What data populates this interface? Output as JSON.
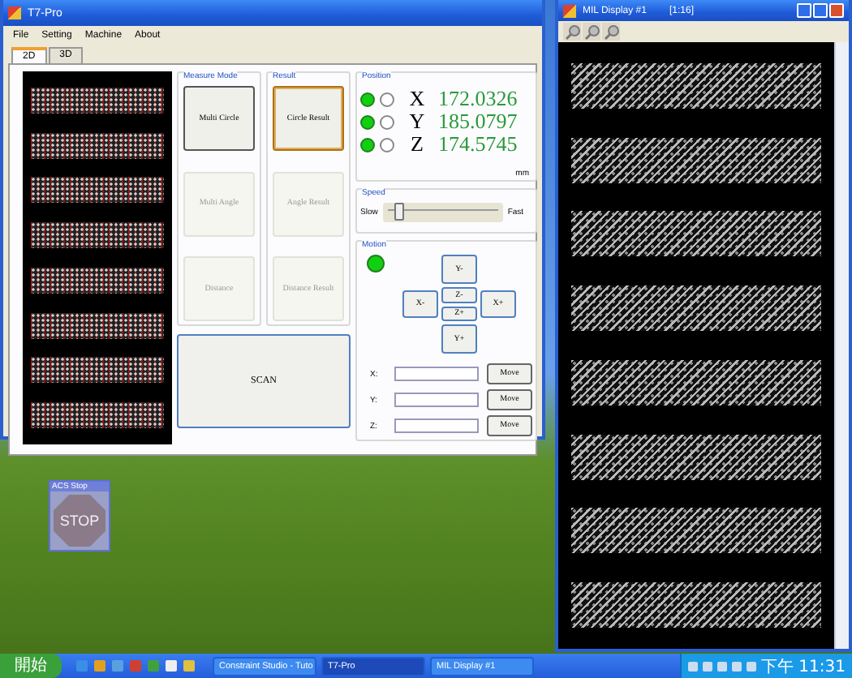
{
  "main_window": {
    "title": "T7-Pro",
    "menu": [
      "File",
      "Setting",
      "Machine",
      "About"
    ],
    "tabs": [
      {
        "label": "2D",
        "selected": true
      },
      {
        "label": "3D",
        "selected": false
      }
    ],
    "measure_mode": {
      "title": "Measure Mode",
      "buttons": [
        {
          "label": "Multi Circle",
          "disabled": false,
          "focused": false
        },
        {
          "label": "Multi Angle",
          "disabled": true,
          "focused": false
        },
        {
          "label": "Distance",
          "disabled": true,
          "focused": false
        }
      ]
    },
    "result": {
      "title": "Result",
      "buttons": [
        {
          "label": "Circle Result",
          "disabled": false,
          "focused": true
        },
        {
          "label": "Angle Result",
          "disabled": true,
          "focused": false
        },
        {
          "label": "Distance Result",
          "disabled": true,
          "focused": false
        }
      ]
    },
    "scan_button": "SCAN",
    "position": {
      "title": "Position",
      "rows": [
        {
          "axis": "X",
          "value": "172.0326",
          "lamp_on": true,
          "ring_on": false
        },
        {
          "axis": "Y",
          "value": "185.0797",
          "lamp_on": true,
          "ring_on": false
        },
        {
          "axis": "Z",
          "value": "174.5745",
          "lamp_on": true,
          "ring_on": false
        }
      ],
      "unit": "mm"
    },
    "speed": {
      "title": "Speed",
      "min_label": "Slow",
      "max_label": "Fast",
      "level": 0.1
    },
    "motion": {
      "title": "Motion",
      "lamp_on": true,
      "jog_buttons": [
        {
          "kind": "y-minus",
          "label": "Y-"
        },
        {
          "kind": "x-minus",
          "label": "X-"
        },
        {
          "kind": "z-minus",
          "label": "Z-"
        },
        {
          "kind": "z-plus",
          "label": "Z+"
        },
        {
          "kind": "x-plus",
          "label": "X+"
        },
        {
          "kind": "y-plus",
          "label": "Y+"
        }
      ],
      "move_rows": [
        {
          "label": "X:",
          "button": "Move"
        },
        {
          "label": "Y:",
          "button": "Move"
        },
        {
          "label": "Z:",
          "button": "Move"
        }
      ]
    }
  },
  "display_window": {
    "title": "MIL Display #1",
    "zoom": "[1:16]"
  },
  "stop_window": {
    "title": "ACS Stop",
    "sign": "STOP"
  },
  "taskbar": {
    "start": "開始",
    "tasks": [
      {
        "label": "Constraint Studio - Tuto",
        "active": false
      },
      {
        "label": "T7-Pro",
        "active": true
      },
      {
        "label": "MIL Display #1",
        "active": false
      }
    ],
    "clock": "下午 11:31"
  }
}
